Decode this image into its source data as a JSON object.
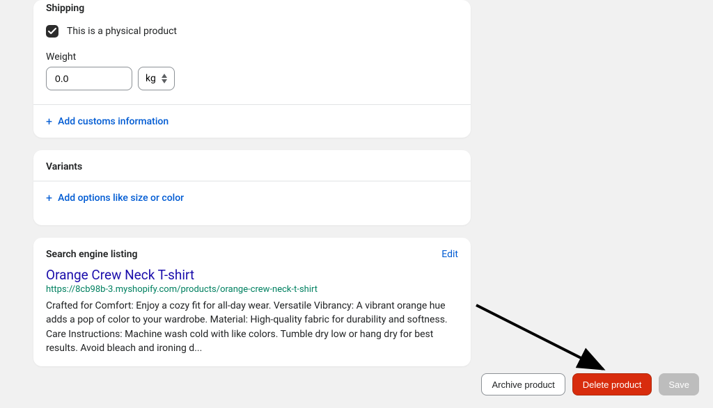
{
  "shipping": {
    "title": "Shipping",
    "physical_label": "This is a physical product",
    "physical_checked": true,
    "weight_label": "Weight",
    "weight_value": "0.0",
    "unit_label": "kg",
    "add_customs_label": "Add customs information"
  },
  "variants": {
    "title": "Variants",
    "add_options_label": "Add options like size or color"
  },
  "seo": {
    "header": "Search engine listing",
    "edit_label": "Edit",
    "title": "Orange Crew Neck T-shirt",
    "url": "https://8cb98b-3.myshopify.com/products/orange-crew-neck-t-shirt",
    "description": "Crafted for Comfort: Enjoy a cozy fit for all-day wear. Versatile Vibrancy: A vibrant orange hue adds a pop of color to your wardrobe. Material: High-quality fabric for durability and softness. Care Instructions: Machine wash cold with like colors. Tumble dry low or hang dry for best results. Avoid bleach and ironing d..."
  },
  "actions": {
    "archive_label": "Archive product",
    "delete_label": "Delete product",
    "save_label": "Save"
  }
}
